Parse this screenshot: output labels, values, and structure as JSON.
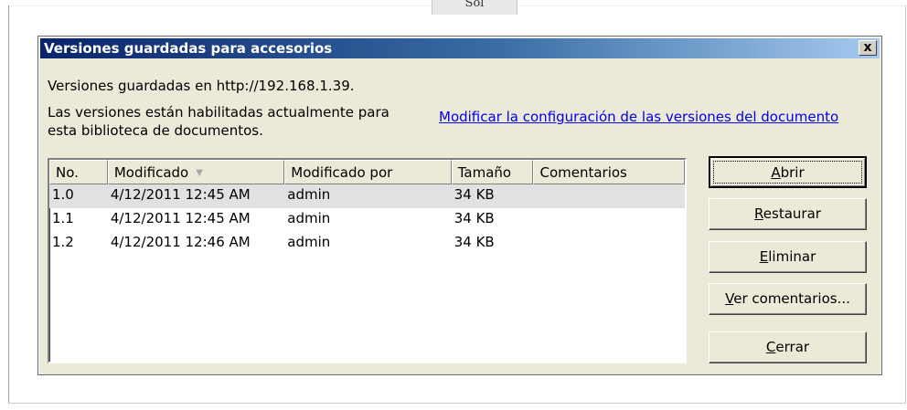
{
  "background": {
    "fragment_text": "Sol"
  },
  "dialog": {
    "title": "Versiones guardadas para accesorios",
    "close_glyph": "x",
    "saved_in": "Versiones guardadas en http://192.168.1.39.",
    "versioning_status": "Las versiones están habilitadas actualmente para esta biblioteca de documentos.",
    "config_link": "Modificar la configuración de las versiones del documento"
  },
  "table": {
    "columns": [
      "No.",
      "Modificado",
      "Modificado por",
      "Tamaño",
      "Comentarios"
    ],
    "sort_indicator": "▼",
    "rows": [
      {
        "no": "1.0",
        "modified": "4/12/2011 12:45 AM",
        "modified_by": "admin",
        "size": "34 KB",
        "comments": ""
      },
      {
        "no": "1.1",
        "modified": "4/12/2011 12:45 AM",
        "modified_by": "admin",
        "size": "34 KB",
        "comments": ""
      },
      {
        "no": "1.2",
        "modified": "4/12/2011 12:46 AM",
        "modified_by": "admin",
        "size": "34 KB",
        "comments": ""
      }
    ],
    "selected_row": 0
  },
  "buttons": {
    "open": {
      "mnemonic": "A",
      "rest": "brir"
    },
    "restore": {
      "mnemonic": "R",
      "rest": "estaurar"
    },
    "delete": {
      "mnemonic": "E",
      "rest": "liminar"
    },
    "view_comments": {
      "mnemonic": "V",
      "rest": "er comentarios..."
    },
    "close": {
      "mnemonic": "C",
      "rest": "errar"
    }
  }
}
